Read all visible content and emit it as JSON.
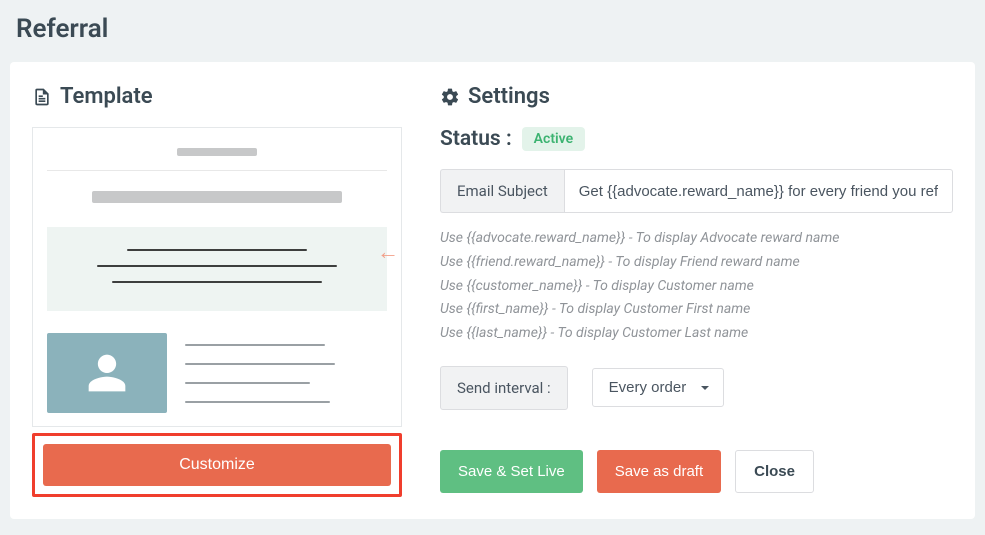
{
  "page": {
    "title": "Referral"
  },
  "template": {
    "heading": "Template",
    "customize_label": "Customize"
  },
  "settings": {
    "heading": "Settings",
    "status_label": "Status :",
    "status_value": "Active",
    "email_subject_label": "Email Subject",
    "email_subject_value": "Get {{advocate.reward_name}} for every friend you refer",
    "hints": [
      "Use {{advocate.reward_name}} - To display Advocate reward name",
      "Use {{friend.reward_name}} - To display Friend reward name",
      "Use {{customer_name}} - To display Customer name",
      "Use {{first_name}} - To display Customer First name",
      "Use {{last_name}} - To display Customer Last name"
    ],
    "send_interval_label": "Send interval :",
    "send_interval_value": "Every order",
    "send_interval_options": [
      "Every order"
    ],
    "actions": {
      "save_live": "Save & Set Live",
      "save_draft": "Save as draft",
      "close": "Close"
    }
  }
}
